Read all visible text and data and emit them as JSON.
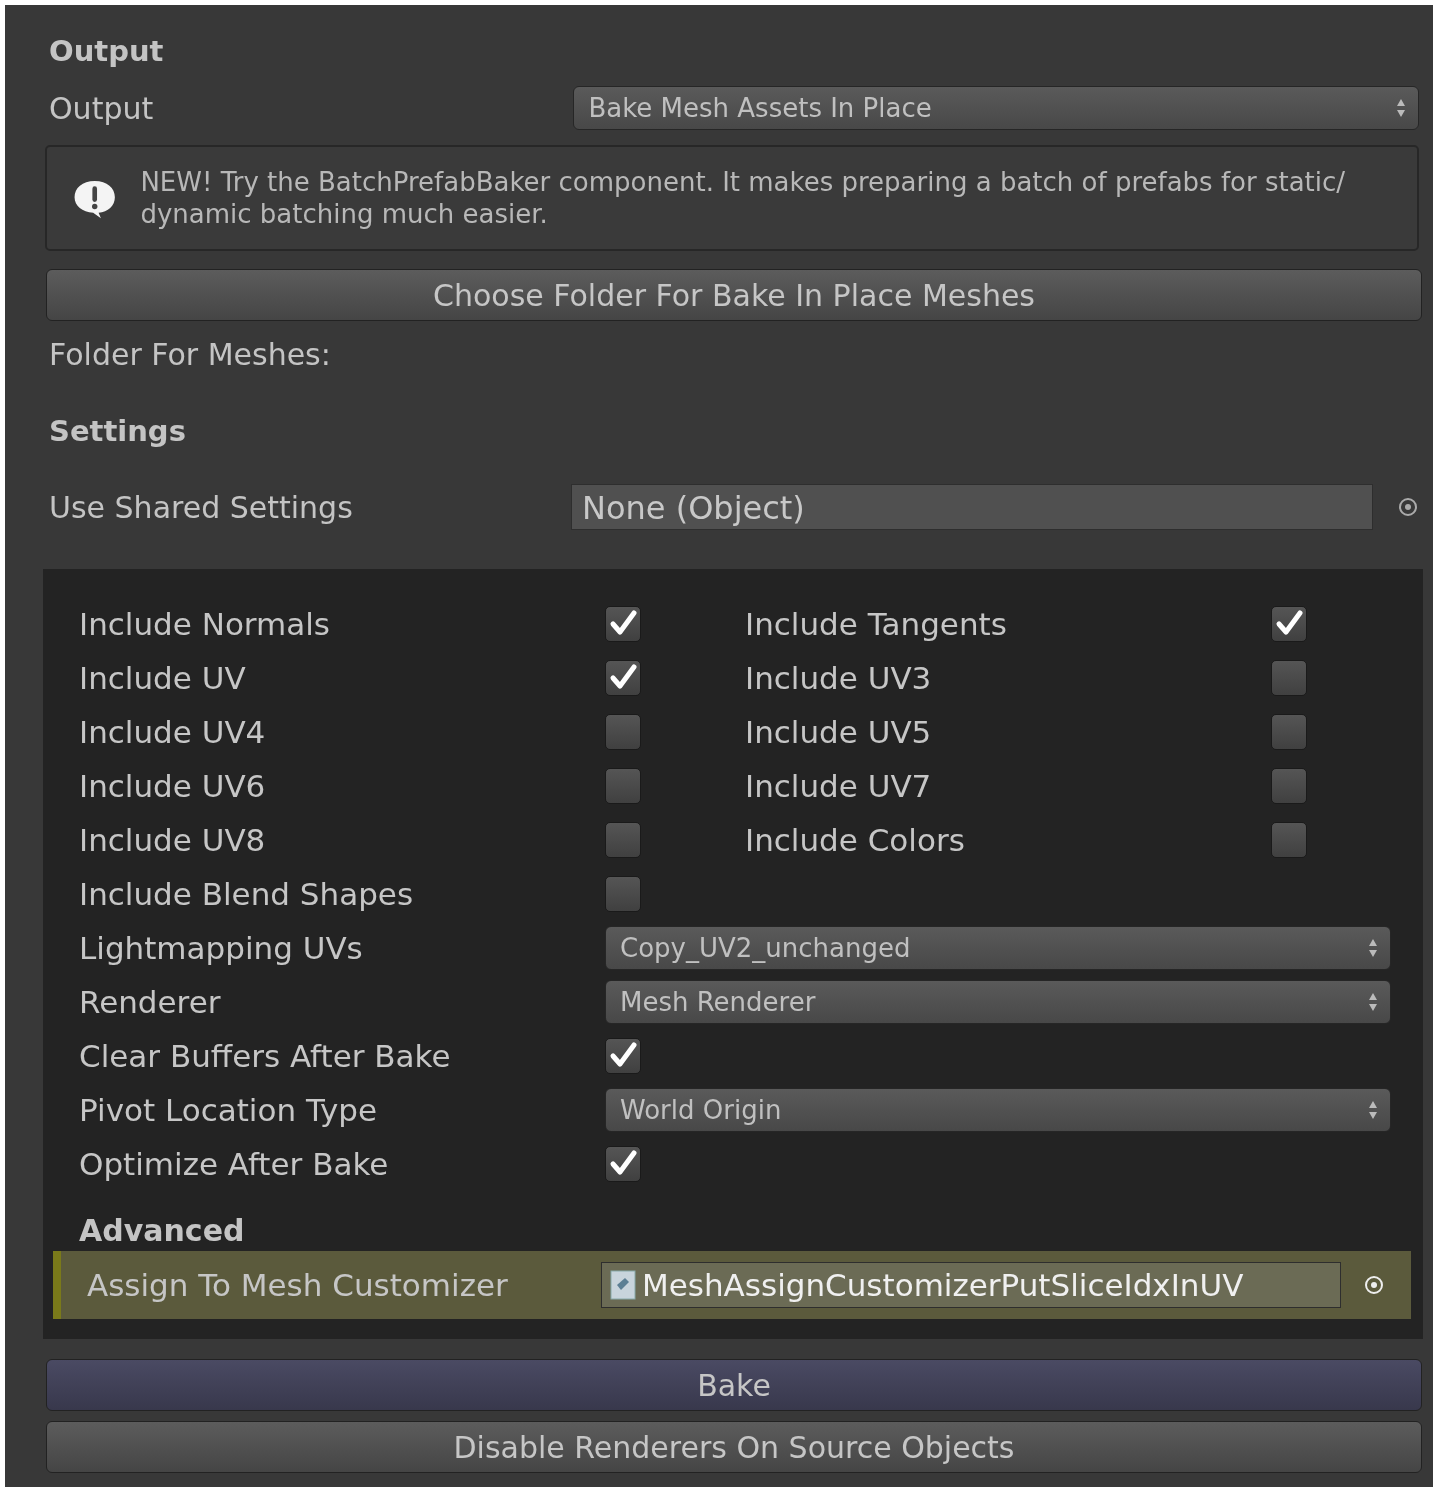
{
  "output_section": {
    "title": "Output",
    "field": {
      "label": "Output",
      "value": "Bake Mesh Assets In Place"
    }
  },
  "help_box": {
    "text": "NEW! Try the BatchPrefabBaker component. It makes preparing a batch of prefabs for static/ dynamic batching much easier."
  },
  "choose_folder_button": "Choose Folder For Bake In Place Meshes",
  "folder_label": "Folder For Meshes:",
  "settings_section": {
    "title": "Settings",
    "shared_settings": {
      "label": "Use Shared Settings",
      "value": "None (Object)"
    }
  },
  "options": [
    {
      "kind": "pair",
      "left": {
        "label": "Include Normals",
        "checked": true
      },
      "right": {
        "label": "Include Tangents",
        "checked": true
      }
    },
    {
      "kind": "pair",
      "left": {
        "label": "Include UV",
        "checked": true
      },
      "right": {
        "label": "Include UV3",
        "checked": false
      }
    },
    {
      "kind": "pair",
      "left": {
        "label": "Include UV4",
        "checked": false
      },
      "right": {
        "label": "Include UV5",
        "checked": false
      }
    },
    {
      "kind": "pair",
      "left": {
        "label": "Include UV6",
        "checked": false
      },
      "right": {
        "label": "Include UV7",
        "checked": false
      }
    },
    {
      "kind": "pair",
      "left": {
        "label": "Include UV8",
        "checked": false
      },
      "right": {
        "label": "Include Colors",
        "checked": false
      }
    },
    {
      "kind": "checkbox",
      "label": "Include Blend Shapes",
      "checked": false
    },
    {
      "kind": "dropdown",
      "label": "Lightmapping UVs",
      "value": "Copy_UV2_unchanged"
    },
    {
      "kind": "dropdown",
      "label": "Renderer",
      "value": "Mesh Renderer"
    },
    {
      "kind": "checkbox",
      "label": "Clear Buffers After Bake",
      "checked": true
    },
    {
      "kind": "dropdown",
      "label": "Pivot Location Type",
      "value": "World Origin"
    },
    {
      "kind": "checkbox",
      "label": "Optimize After Bake",
      "checked": true
    }
  ],
  "advanced": {
    "title": "Advanced",
    "field": {
      "label": "Assign To Mesh Customizer",
      "value": "MeshAssignCustomizerPutSliceIdxInUV",
      "highlighted": true
    }
  },
  "buttons": [
    {
      "label": "Bake",
      "kind": "primary"
    },
    {
      "label": "Disable Renderers On Source Objects",
      "kind": "normal"
    }
  ]
}
